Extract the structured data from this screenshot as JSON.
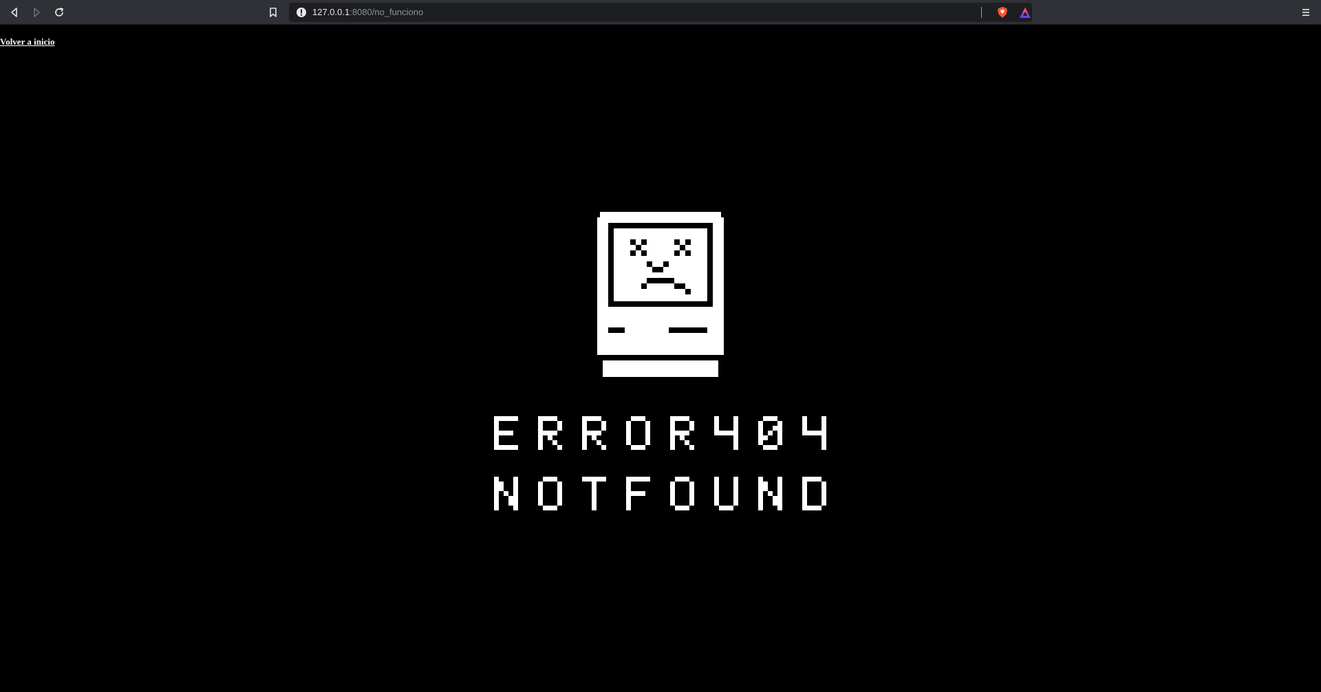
{
  "browser": {
    "url_host": "127.0.0.1",
    "url_rest": ":8080/no_funciono"
  },
  "page": {
    "home_link": "Volver a inicio",
    "error_line1": [
      "E",
      "R",
      "R",
      "O",
      "R",
      "4",
      "0",
      "4"
    ],
    "error_line2": [
      "N",
      "O",
      "T",
      "F",
      "O",
      "U",
      "N",
      "D"
    ]
  },
  "colors": {
    "toolbar_bg": "#2f3136",
    "url_bar_bg": "#1d1e22",
    "page_bg": "#000000",
    "foreground": "#ffffff",
    "brave_orange": "#fb542b"
  },
  "icons": [
    "back-icon",
    "forward-icon",
    "reload-icon",
    "bookmark-icon",
    "site-info-icon",
    "brave-shields-icon",
    "brave-rewards-icon",
    "menu-icon"
  ]
}
